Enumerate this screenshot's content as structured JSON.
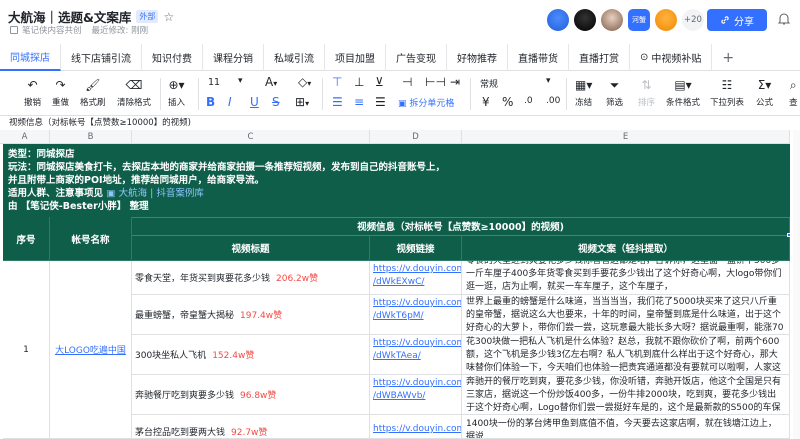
{
  "header": {
    "title": "大航海｜选题&文案库",
    "tag": "外部",
    "owner": "笔记侠内容共创",
    "modified": "最近修改: 刚刚",
    "avatar_extra": "河蟹",
    "avatar_more": "+20",
    "share_label": "分享"
  },
  "tabs": [
    "同城探店",
    "线下店铺引流",
    "知识付费",
    "课程分销",
    "私域引流",
    "项目加盟",
    "广告变现",
    "好物推荐",
    "直播带货",
    "直播打赏",
    "中视频补贴",
    "+"
  ],
  "toolbar": {
    "undo": "撤销",
    "redo": "重做",
    "format_painter": "格式刷",
    "clear_format": "清除格式",
    "insert": "插入",
    "font_size": "11",
    "merge": "拆分单元格",
    "number_format": "常规",
    "freeze": "冻结",
    "filter": "筛选",
    "sort": "排序",
    "cond_format": "条件格式",
    "dropdown": "下拉列表",
    "formula": "公式",
    "more": "查"
  },
  "formula_bar": "视频信息（对标帐号【点赞数≥10000】的视频)",
  "columns": [
    "A",
    "B",
    "C",
    "D",
    "E"
  ],
  "banner": {
    "line1": "类型：同城探店",
    "line2": "玩法：同城探店美食打卡，去探店本地的商家并给商家拍摄一条推荐短视频，发布到自己的抖音账号上，",
    "line3": "并且附带上商家的POI地址，推荐给同城用户，给商家导流。",
    "line4": "适用人群、注意事项见",
    "line4_link": "大航海 | 抖音案例库",
    "line5": "由 【笔记侠-Bester小胖】 整理"
  },
  "table_header": {
    "index": "序号",
    "account": "帐号名称",
    "group": "视频信息（对标帐号【点赞数≥10000】的视频)",
    "video_title": "视频标题",
    "video_link": "视频链接",
    "video_text": "视频文案（轻抖提取）"
  },
  "row": {
    "index": "1",
    "account": "大LOGO吃遍中国"
  },
  "videos": [
    {
      "title": "零食天堂，年货买到爽要花多少钱",
      "likes": "206.2w赞",
      "link1": "https://v.douyin.com",
      "link2": "/dWkEXwC/",
      "text": "零食的天堂进到爽要花多少钱你看看这都是啥，告诉你，这里面一盒饼干500多一斤车厘子400多年货零食买到手要花多少钱出了这个好奇心啊，大logo带你们逛一逛，店为止啊，就买一车车厘子，这个车厘子，"
    },
    {
      "title": "最重螃蟹，帝皇蟹大揭秘",
      "likes": "197.4w赞",
      "link1": "https://v.douyin.com",
      "link2": "/dWkT6pM/",
      "text": "世界上最重的螃蟹是什么味道，当当当当，我们花了5000块买来了这只八斤重的皇帝蟹，据说这么大也要来，十年的时间，皇帝蟹到底是什么味道，出于这个好奇心的大萝卜，带你们尝一尝，这玩意最大能长多大呀？据说最重啊，能涨70多"
    },
    {
      "title": "300块坐私人飞机",
      "likes": "152.4w赞",
      "link1": "https://v.douyin.com",
      "link2": "/dWkTAea/",
      "text": "花300块做一把私人飞机是什么体验？赵总，我就不跟你砍价了啊，前两个600额，这个飞机是多少钱3亿左右啊？私人飞机到底什么样出于这个好奇心，那大味替你们体验一下，今天咱们也体验一把贵宾通道都没有要就可以啦啊，人家这个都"
    },
    {
      "title": "奔驰餐厅吃到爽要多少钱",
      "likes": "96.8w赞",
      "link1": "https://v.douyin.com",
      "link2": "/dWBAWvb/",
      "text": "奔驰开的餐厅吃到爽，要花多少钱，你没听错，奔驰开饭店，他这个全国是只有三家店，据说这一个份炒饭400多，一份牛排2000块，吃到爽，要花多少钱出于这个好奇心啊，Logo替你们尝一尝挺好车是的，这个是最新款的S500的车保险的"
    },
    {
      "title": "茅台控品吃到要两大钱",
      "likes": "92.7w赞",
      "link1": "https://v.douyin.com",
      "link2": "",
      "text": "1400块一份的茅台烤甲鱼到底值不值，今天要去这家店啊，就在钱塘江边上，据说"
    }
  ]
}
